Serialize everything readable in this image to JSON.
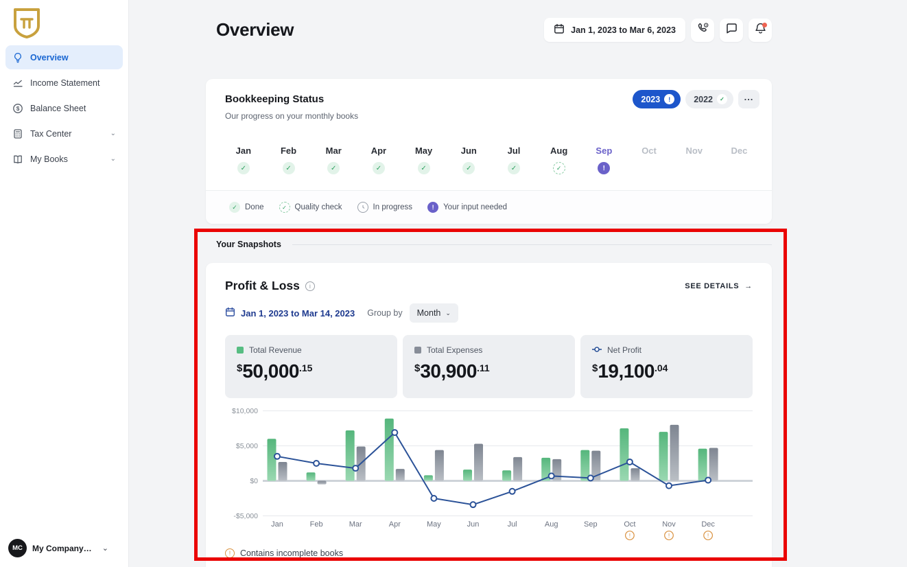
{
  "sidebar": {
    "items": [
      {
        "label": "Overview",
        "icon": "lightbulb",
        "active": true
      },
      {
        "label": "Income Statement",
        "icon": "line-chart",
        "active": false
      },
      {
        "label": "Balance Sheet",
        "icon": "dollar-circle",
        "active": false
      },
      {
        "label": "Tax Center",
        "icon": "calculator",
        "active": false,
        "expandable": true
      },
      {
        "label": "My Books",
        "icon": "book",
        "active": false,
        "expandable": true
      }
    ],
    "company": {
      "initials": "MC",
      "name": "My Company…"
    }
  },
  "header": {
    "title": "Overview",
    "date_range": "Jan 1, 2023 to Mar 6, 2023",
    "icons": [
      "phone-call-icon",
      "chat-icon",
      "notifications-bell-icon"
    ]
  },
  "bookkeeping": {
    "title": "Bookkeeping Status",
    "subtitle": "Our progress on your monthly books",
    "years": [
      {
        "label": "2023",
        "badge": "input-needed",
        "active": true
      },
      {
        "label": "2022",
        "badge": "done",
        "active": false
      }
    ],
    "more_label": "...",
    "months": [
      {
        "label": "Jan",
        "status": "done"
      },
      {
        "label": "Feb",
        "status": "done"
      },
      {
        "label": "Mar",
        "status": "done"
      },
      {
        "label": "Apr",
        "status": "done"
      },
      {
        "label": "May",
        "status": "done"
      },
      {
        "label": "Jun",
        "status": "done"
      },
      {
        "label": "Jul",
        "status": "done"
      },
      {
        "label": "Aug",
        "status": "quality"
      },
      {
        "label": "Sep",
        "status": "input"
      },
      {
        "label": "Oct",
        "status": "none"
      },
      {
        "label": "Nov",
        "status": "none"
      },
      {
        "label": "Dec",
        "status": "none"
      }
    ],
    "legend": [
      {
        "label": "Done",
        "icon": "check"
      },
      {
        "label": "Quality check",
        "icon": "quality"
      },
      {
        "label": "In progress",
        "icon": "clock"
      },
      {
        "label": "Your input needed",
        "icon": "input"
      }
    ]
  },
  "snapshots": {
    "title": "Your Snapshots"
  },
  "pnl": {
    "title": "Profit & Loss",
    "see_details": "SEE DETAILS",
    "see_details_arrow": "→",
    "date_range": "Jan 1, 2023 to Mar 14, 2023",
    "group_by_label": "Group by",
    "group_by_value": "Month",
    "stats": [
      {
        "label": "Total Revenue",
        "currency": "$",
        "dollars": "50,000",
        "cents": ".15",
        "swatch": "green"
      },
      {
        "label": "Total Expenses",
        "currency": "$",
        "dollars": "30,900",
        "cents": ".11",
        "swatch": "gray"
      },
      {
        "label": "Net Profit",
        "currency": "$",
        "dollars": "19,100",
        "cents": ".04",
        "swatch": "line-marker"
      }
    ],
    "footnote": "Contains incomplete books"
  },
  "chart_data": {
    "type": "bar+line",
    "categories": [
      "Jan",
      "Feb",
      "Mar",
      "Apr",
      "May",
      "Jun",
      "Jul",
      "Aug",
      "Sep",
      "Oct",
      "Nov",
      "Dec"
    ],
    "series": [
      {
        "name": "Total Revenue",
        "type": "bar",
        "color_top": "#55b67c",
        "color_bottom": "#9ad8b1",
        "values": [
          6000,
          1200,
          7200,
          8900,
          800,
          1600,
          1500,
          3300,
          4400,
          7500,
          7000,
          4600
        ]
      },
      {
        "name": "Total Expenses",
        "type": "bar",
        "color_top": "#7e8591",
        "color_bottom": "#babfc5",
        "values": [
          2700,
          -500,
          4900,
          1700,
          4400,
          5300,
          3400,
          3100,
          4300,
          1800,
          8000,
          4700
        ]
      },
      {
        "name": "Net Profit",
        "type": "line",
        "color": "#2b5298",
        "values": [
          3500,
          2500,
          1800,
          6900,
          -2500,
          -3400,
          -1500,
          700,
          400,
          2700,
          -700,
          100
        ]
      }
    ],
    "yticks": [
      {
        "value": 10000,
        "label": "$10,000"
      },
      {
        "value": 5000,
        "label": "$5,000"
      },
      {
        "value": 0,
        "label": "$0"
      },
      {
        "value": -5000,
        "label": "-$5,000"
      }
    ],
    "ylim": [
      -6500,
      10500
    ],
    "grid": true,
    "legend_position": "in-stat-cards",
    "incomplete_months": [
      "Oct",
      "Nov",
      "Dec"
    ],
    "incomplete_marker": "!"
  },
  "annotation": {
    "shape": "rectangle",
    "color": "#ea0303"
  }
}
